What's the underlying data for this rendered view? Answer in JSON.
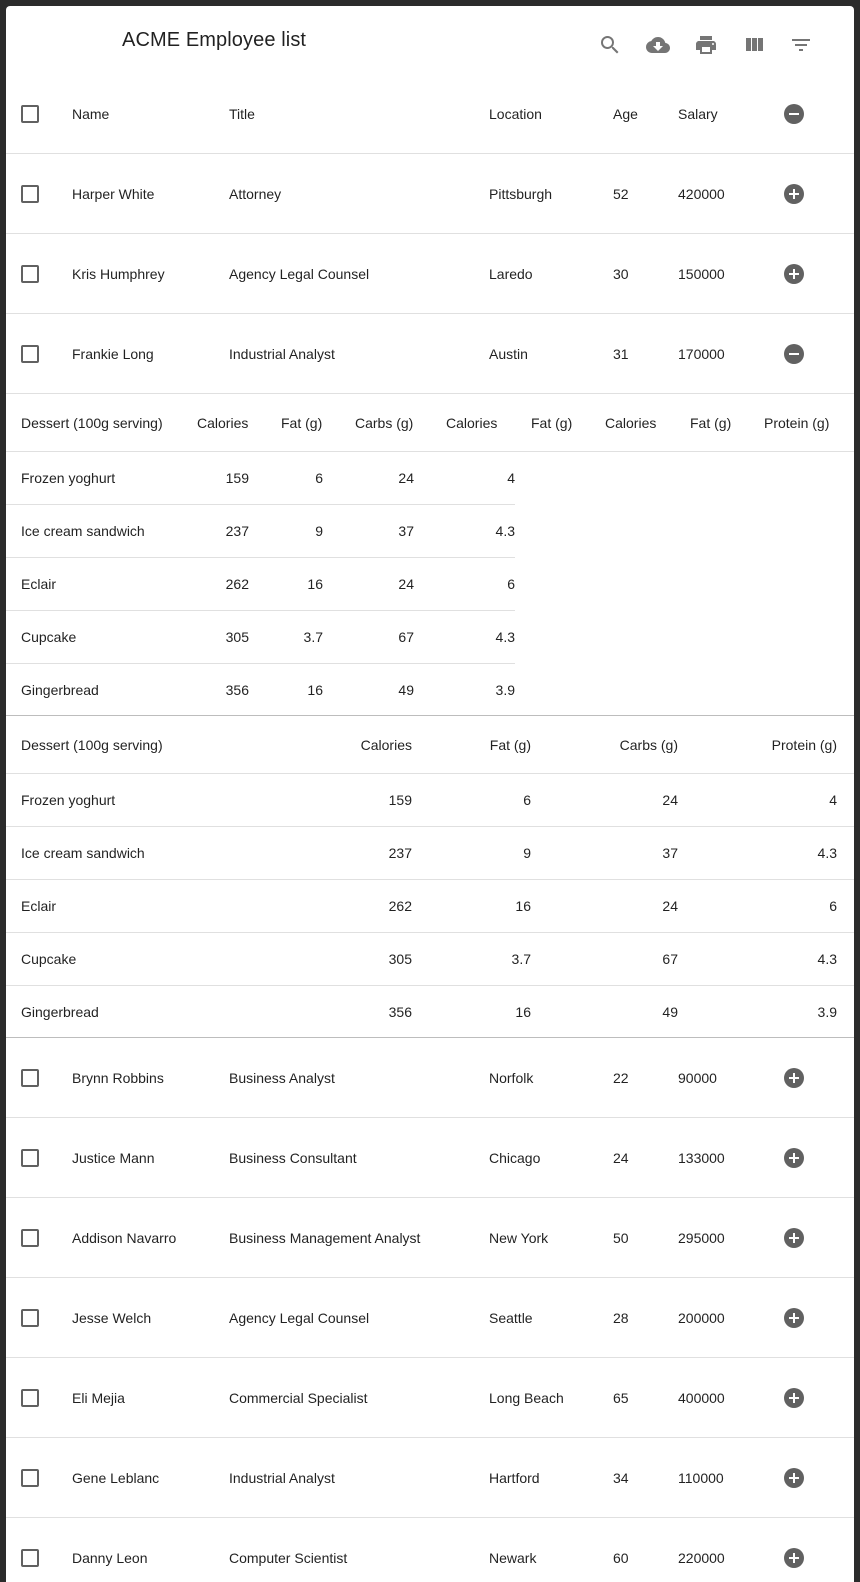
{
  "toolbar": {
    "title": "ACME Employee list",
    "icons": [
      "search-icon",
      "cloud-download-icon",
      "print-icon",
      "view-column-icon",
      "filter-list-icon"
    ]
  },
  "table": {
    "columns": [
      "Name",
      "Title",
      "Location",
      "Age",
      "Salary"
    ],
    "rows_top": [
      {
        "name": "Harper White",
        "title": "Attorney",
        "location": "Pittsburgh",
        "age": "52",
        "salary": "420000",
        "expanded": false
      },
      {
        "name": "Kris Humphrey",
        "title": "Agency Legal Counsel",
        "location": "Laredo",
        "age": "30",
        "salary": "150000",
        "expanded": false
      },
      {
        "name": "Frankie Long",
        "title": "Industrial Analyst",
        "location": "Austin",
        "age": "31",
        "salary": "170000",
        "expanded": true
      }
    ],
    "rows_bottom": [
      {
        "name": "Brynn Robbins",
        "title": "Business Analyst",
        "location": "Norfolk",
        "age": "22",
        "salary": "90000",
        "expanded": false
      },
      {
        "name": "Justice Mann",
        "title": "Business Consultant",
        "location": "Chicago",
        "age": "24",
        "salary": "133000",
        "expanded": false
      },
      {
        "name": "Addison Navarro",
        "title": "Business Management Analyst",
        "location": "New York",
        "age": "50",
        "salary": "295000",
        "expanded": false
      },
      {
        "name": "Jesse Welch",
        "title": "Agency Legal Counsel",
        "location": "Seattle",
        "age": "28",
        "salary": "200000",
        "expanded": false
      },
      {
        "name": "Eli Mejia",
        "title": "Commercial Specialist",
        "location": "Long Beach",
        "age": "65",
        "salary": "400000",
        "expanded": false
      },
      {
        "name": "Gene Leblanc",
        "title": "Industrial Analyst",
        "location": "Hartford",
        "age": "34",
        "salary": "110000",
        "expanded": false
      },
      {
        "name": "Danny Leon",
        "title": "Computer Scientist",
        "location": "Newark",
        "age": "60",
        "salary": "220000",
        "expanded": false
      }
    ]
  },
  "nested1": {
    "headers": [
      "Dessert (100g serving)",
      "Calories",
      "Fat (g)",
      "Carbs (g)",
      "Calories",
      "Fat (g)",
      "Calories",
      "Fat (g)",
      "Protein (g)"
    ],
    "rows": [
      [
        "Frozen yoghurt",
        "159",
        "6",
        "24",
        "4"
      ],
      [
        "Ice cream sandwich",
        "237",
        "9",
        "37",
        "4.3"
      ],
      [
        "Eclair",
        "262",
        "16",
        "24",
        "6"
      ],
      [
        "Cupcake",
        "305",
        "3.7",
        "67",
        "4.3"
      ],
      [
        "Gingerbread",
        "356",
        "16",
        "49",
        "3.9"
      ]
    ]
  },
  "nested2": {
    "headers": [
      "Dessert (100g serving)",
      "Calories",
      "Fat (g)",
      "Carbs (g)",
      "Protein (g)"
    ],
    "rows": [
      [
        "Frozen yoghurt",
        "159",
        "6",
        "24",
        "4"
      ],
      [
        "Ice cream sandwich",
        "237",
        "9",
        "37",
        "4.3"
      ],
      [
        "Eclair",
        "262",
        "16",
        "24",
        "6"
      ],
      [
        "Cupcake",
        "305",
        "3.7",
        "67",
        "4.3"
      ],
      [
        "Gingerbread",
        "356",
        "16",
        "49",
        "3.9"
      ]
    ]
  },
  "colors": {
    "icon": "#757575",
    "expand_icon": "#616161",
    "divider": "#e0e0e0",
    "background": "#ffffff"
  }
}
